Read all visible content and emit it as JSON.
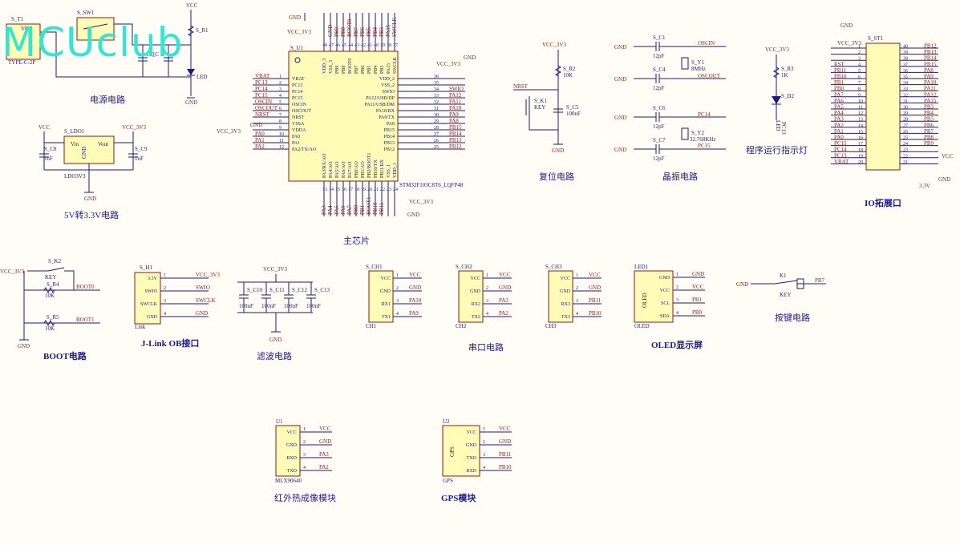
{
  "watermark": "MCUclub",
  "sections": {
    "power": "电源电路",
    "ldo": "5V转3.3V电路",
    "mcu": "主芯片",
    "reset": "复位电路",
    "crystal": "晶振电路",
    "led_ind": "程序运行指示灯",
    "io": "IO拓展口",
    "boot": "BOOT电路",
    "jlink": "J-Link OB接口",
    "filter": "滤波电路",
    "uart": "串口电路",
    "oled": "OLED显示屏",
    "key": "按键电路",
    "ir": "红外热成像模块",
    "gps": "GPS模块"
  },
  "power": {
    "usb_ref": "S_T1",
    "usb_type": "TYPE-C-2P",
    "sw_ref": "S_SW1",
    "r_ref": "S_R1",
    "c_ref": "S_C",
    "cap_val": "100",
    "vcc": "VCC",
    "gnd": "GND",
    "led": "LED"
  },
  "ldo": {
    "ref": "S_LDO1",
    "part": "LDO3V3",
    "vin": "Vin",
    "vout": "Vout",
    "gnd": "GND",
    "c8": "S_C8",
    "c9": "S_C9",
    "cval": "1uF",
    "vcc": "VCC",
    "vcc3": "VCC_3V3"
  },
  "mcu": {
    "ref": "S_U1",
    "part": "STM32F103C8T6_LQFP48",
    "vcc3": "VCC_3V3",
    "gnd": "GND",
    "left_pins": [
      {
        "num": "1",
        "name": "VBAT",
        "net": "VBAT"
      },
      {
        "num": "2",
        "name": "PC13",
        "net": "PC13"
      },
      {
        "num": "3",
        "name": "PC14",
        "net": "PC14"
      },
      {
        "num": "4",
        "name": "PC15",
        "net": "PC15"
      },
      {
        "num": "5",
        "name": "OSCIN",
        "net": "OSCIN"
      },
      {
        "num": "6",
        "name": "OSCOUT",
        "net": "OSCOUT"
      },
      {
        "num": "7",
        "name": "NRST",
        "net": "NRST"
      },
      {
        "num": "8",
        "name": "VSSA",
        "net": "GND"
      },
      {
        "num": "9",
        "name": "VDDA",
        "net": "VCC_3V3"
      },
      {
        "num": "10",
        "name": "PA0",
        "net": "PA0"
      },
      {
        "num": "11",
        "name": "PA1",
        "net": "PA1"
      },
      {
        "num": "12",
        "name": "PA2/TX/AO",
        "net": "PA2"
      }
    ],
    "right_pins": [
      {
        "num": "36",
        "name": "VDD_2",
        "net": "VCC_3V3"
      },
      {
        "num": "35",
        "name": "VSS_2",
        "net": "GND"
      },
      {
        "num": "34",
        "name": "SWIO",
        "net": "SWIO"
      },
      {
        "num": "33",
        "name": "PA12/USB/DP",
        "net": "PA12"
      },
      {
        "num": "32",
        "name": "PA11/USB/DM",
        "net": "PA11"
      },
      {
        "num": "31",
        "name": "PA10/RX",
        "net": "PA10"
      },
      {
        "num": "30",
        "name": "PA9/TX",
        "net": "PA9"
      },
      {
        "num": "29",
        "name": "PA8",
        "net": "PA8"
      },
      {
        "num": "28",
        "name": "PB15",
        "net": "PB15"
      },
      {
        "num": "27",
        "name": "PB14",
        "net": "PB14"
      },
      {
        "num": "26",
        "name": "PB13",
        "net": "PB13"
      },
      {
        "num": "25",
        "name": "PB12",
        "net": "PB12"
      }
    ],
    "top_pins": [
      {
        "num": "48",
        "name": "VDD_3"
      },
      {
        "num": "47",
        "name": "VSS_3"
      },
      {
        "num": "46",
        "name": "PB9"
      },
      {
        "num": "45",
        "name": "PB8"
      },
      {
        "num": "44",
        "name": "BOOT0"
      },
      {
        "num": "43",
        "name": "PB7"
      },
      {
        "num": "42",
        "name": "PB6"
      },
      {
        "num": "41",
        "name": "PB5"
      },
      {
        "num": "40",
        "name": "PB4"
      },
      {
        "num": "39",
        "name": "PB3"
      },
      {
        "num": "38",
        "name": "PA15"
      },
      {
        "num": "37",
        "name": "SWCLK"
      }
    ],
    "top_nets": [
      "GND",
      "PB9",
      "PB8",
      "BOOT0",
      "PB7",
      "PB6",
      "PB5",
      "PB4",
      "PB3",
      "PA15",
      "SWCLK"
    ],
    "bottom_pins": [
      {
        "num": "13",
        "name": "PA3/RX/AO"
      },
      {
        "num": "14",
        "name": "PA4/AO"
      },
      {
        "num": "15",
        "name": "PA5/AO"
      },
      {
        "num": "16",
        "name": "PA6/AO"
      },
      {
        "num": "17",
        "name": "PA7/AO"
      },
      {
        "num": "18",
        "name": "PB0/AO"
      },
      {
        "num": "19",
        "name": "PB1/AO"
      },
      {
        "num": "20",
        "name": "PB2/BOOT1"
      },
      {
        "num": "21",
        "name": "PB10/TX"
      },
      {
        "num": "22",
        "name": "PB11/RX"
      },
      {
        "num": "23",
        "name": "VSS_1"
      },
      {
        "num": "24",
        "name": "VDD_1"
      }
    ],
    "bottom_nets": [
      "PA3",
      "PA4",
      "PA5",
      "PA6",
      "PA7",
      "PB0",
      "PB1",
      "BOOT1",
      "PB10",
      "PB11"
    ]
  },
  "reset": {
    "vcc3": "VCC_3V3",
    "r_ref": "S_R2",
    "r_val": "10K",
    "k_ref": "S_K1",
    "k_val": "KEY",
    "c_ref": "S_C5",
    "c_val": "100nF",
    "nrst": "NRST",
    "gnd": "GND"
  },
  "crystal": {
    "c1": "S_C1",
    "c4": "S_C4",
    "c6": "S_C6",
    "c7": "S_C7",
    "cval": "12pF",
    "gnd": "GND",
    "y1": "S_Y1",
    "y1_val": "8MHz",
    "y2": "S_Y2",
    "y2_val": "32.768KHz",
    "oscin": "OSCIN",
    "oscout": "OSCOUT",
    "pc14": "PC14",
    "pc15": "PC15"
  },
  "led_ind": {
    "vcc3": "VCC_3V3",
    "r_ref": "S_R3",
    "r_val": "1K",
    "d_ref": "S_D2",
    "d_val": "LED",
    "net": "PC13"
  },
  "io": {
    "ref": "S_ST1",
    "vcc3": "VCC_3V3",
    "gnd": "GND",
    "vcc": "VCC",
    "v33": "3.3V",
    "left": [
      {
        "num": "1",
        "net": ""
      },
      {
        "num": "2",
        "net": ""
      },
      {
        "num": "3",
        "net": ""
      },
      {
        "num": "4",
        "net": "RST"
      },
      {
        "num": "5",
        "net": "PB11"
      },
      {
        "num": "6",
        "net": "PB10"
      },
      {
        "num": "7",
        "net": "PB1"
      },
      {
        "num": "8",
        "net": "PB0"
      },
      {
        "num": "9",
        "net": "PA7"
      },
      {
        "num": "10",
        "net": "PA6"
      },
      {
        "num": "11",
        "net": "PA5"
      },
      {
        "num": "12",
        "net": "PA4"
      },
      {
        "num": "13",
        "net": "PA3"
      },
      {
        "num": "14",
        "net": "PA2"
      },
      {
        "num": "15",
        "net": "PA1"
      },
      {
        "num": "16",
        "net": "PA0"
      },
      {
        "num": "17",
        "net": "PC15"
      },
      {
        "num": "18",
        "net": "PC14"
      },
      {
        "num": "19",
        "net": "PC13"
      },
      {
        "num": "20",
        "net": "VBAT"
      }
    ],
    "right": [
      {
        "num": "40",
        "net": "PB12"
      },
      {
        "num": "39",
        "net": "PB13"
      },
      {
        "num": "38",
        "net": "PB14"
      },
      {
        "num": "37",
        "net": "PB15"
      },
      {
        "num": "36",
        "net": "PA8"
      },
      {
        "num": "35",
        "net": "PA9"
      },
      {
        "num": "34",
        "net": "PA10"
      },
      {
        "num": "33",
        "net": "PA11"
      },
      {
        "num": "32",
        "net": "PA12"
      },
      {
        "num": "31",
        "net": "PA15"
      },
      {
        "num": "30",
        "net": "PB3"
      },
      {
        "num": "29",
        "net": "PB4"
      },
      {
        "num": "28",
        "net": "PB5"
      },
      {
        "num": "27",
        "net": "PB6"
      },
      {
        "num": "26",
        "net": "PB7"
      },
      {
        "num": "25",
        "net": "PB8"
      },
      {
        "num": "24",
        "net": "PB9"
      },
      {
        "num": "23",
        "net": ""
      },
      {
        "num": "22",
        "net": ""
      },
      {
        "num": "21",
        "net": ""
      }
    ]
  },
  "boot": {
    "vcc3": "VCC_3V3",
    "k_ref": "S_K2",
    "k_val": "KEY",
    "r4": "S_R4",
    "r5": "S_R5",
    "rval": "10K",
    "boot0": "BOOT0",
    "boot1": "BOOT1",
    "gnd": "GND"
  },
  "jlink": {
    "ref": "S_H1",
    "sub": "Link",
    "pins": [
      {
        "num": "1",
        "name": "3.3V",
        "net": "VCC_3V3"
      },
      {
        "num": "2",
        "name": "SWIO",
        "net": "SWIO"
      },
      {
        "num": "3",
        "name": "SWCLK",
        "net": "SWCLK"
      },
      {
        "num": "4",
        "name": "GND",
        "net": "GND"
      }
    ]
  },
  "filter": {
    "vcc3": "VCC_3V3",
    "gnd": "GND",
    "caps": [
      {
        "ref": "S_C10",
        "val": "100nF"
      },
      {
        "ref": "S_C11",
        "val": "100nF"
      },
      {
        "ref": "S_C12",
        "val": "100nF"
      },
      {
        "ref": "S_C13",
        "val": "100nF"
      }
    ]
  },
  "uart": [
    {
      "ref": "S_CH1",
      "sub": "CH1",
      "pins": [
        {
          "num": "1",
          "name": "VCC",
          "net": "VCC"
        },
        {
          "num": "2",
          "name": "GND",
          "net": "GND"
        },
        {
          "num": "3",
          "name": "RX1",
          "net": "PA10"
        },
        {
          "num": "4",
          "name": "TX1",
          "net": "PA9"
        }
      ]
    },
    {
      "ref": "S_CH2",
      "sub": "CH2",
      "pins": [
        {
          "num": "1",
          "name": "VCC",
          "net": "VCC"
        },
        {
          "num": "2",
          "name": "GND",
          "net": "GND"
        },
        {
          "num": "3",
          "name": "RX2",
          "net": "PA3"
        },
        {
          "num": "4",
          "name": "TX2",
          "net": "PA2"
        }
      ]
    },
    {
      "ref": "S_CH3",
      "sub": "CH3",
      "pins": [
        {
          "num": "1",
          "name": "VCC",
          "net": "VCC"
        },
        {
          "num": "2",
          "name": "GND",
          "net": "GND"
        },
        {
          "num": "3",
          "name": "RX3",
          "net": "PB11"
        },
        {
          "num": "4",
          "name": "TX3",
          "net": "PB10"
        }
      ]
    }
  ],
  "oled": {
    "ref": "LED1",
    "sub": "OLED",
    "vert": "OLED",
    "pins": [
      {
        "num": "1",
        "name": "GND",
        "net": "GND"
      },
      {
        "num": "2",
        "name": "VCC",
        "net": "VCC"
      },
      {
        "num": "3",
        "name": "SCL",
        "net": "PB1"
      },
      {
        "num": "4",
        "name": "SDA",
        "net": "PB0"
      }
    ]
  },
  "key": {
    "ref": "K1",
    "val": "KEY",
    "gnd": "GND",
    "net": "PB7"
  },
  "ir": {
    "ref": "U1",
    "sub": "MLX90640",
    "pins": [
      {
        "num": "1",
        "name": "VCC",
        "net": "VCC"
      },
      {
        "num": "2",
        "name": "GND",
        "net": "GND"
      },
      {
        "num": "3",
        "name": "RXD",
        "net": "PA3"
      },
      {
        "num": "4",
        "name": "TXD",
        "net": "PA2"
      }
    ]
  },
  "gps": {
    "ref": "U2",
    "sub": "GPS",
    "vert": "GPS",
    "pins": [
      {
        "num": "1",
        "name": "VCC",
        "net": "VCC"
      },
      {
        "num": "2",
        "name": "GND",
        "net": "GND"
      },
      {
        "num": "3",
        "name": "TXD",
        "net": "PB11"
      },
      {
        "num": "4",
        "name": "RXD",
        "net": "PB10"
      }
    ]
  },
  "colors": {
    "background": "#fffdf6",
    "component_fill": "#fffcb8",
    "wire": "#1a1a80",
    "net_label": "#8b1a1a",
    "watermark": "#33e6d4"
  }
}
